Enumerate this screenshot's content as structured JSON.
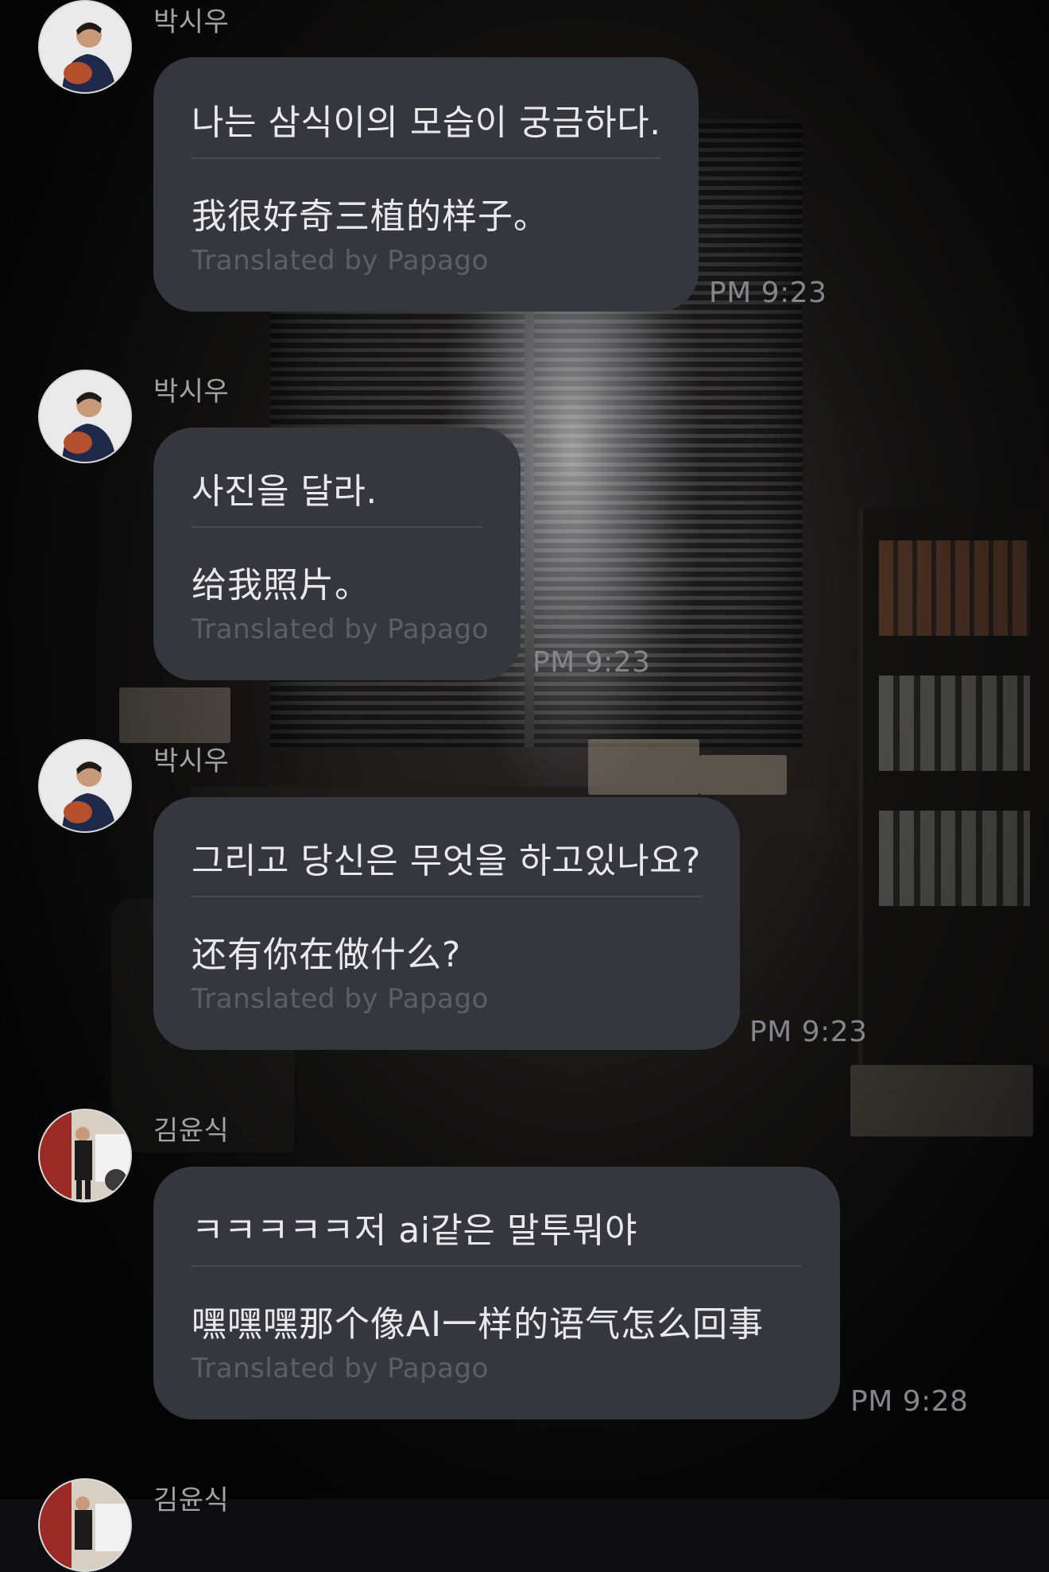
{
  "messages": [
    {
      "sender": "박시우",
      "avatar": "profile-photo",
      "original": "나는 삼식이의 모습이 궁금하다.",
      "translated": "我很好奇三植的样子。",
      "credit": "Translated by Papago",
      "time": "PM 9:23"
    },
    {
      "sender": "박시우",
      "avatar": "profile-photo",
      "original": "사진을 달라.",
      "translated": "给我照片。",
      "credit": "Translated by Papago",
      "time": "PM 9:23"
    },
    {
      "sender": "박시우",
      "avatar": "profile-photo",
      "original": "그리고 당신은 무엇을 하고있나요?",
      "translated": "还有你在做什么?",
      "credit": "Translated by Papago",
      "time": "PM 9:23"
    },
    {
      "sender": "김윤식",
      "avatar": "profile-photo",
      "original": "ㅋㅋㅋㅋㅋ저 ai같은 말투뭐야",
      "translated": "嘿嘿嘿那个像AI一样的语气怎么回事",
      "credit": "Translated by Papago",
      "time": "PM 9:28"
    },
    {
      "sender": "김윤식",
      "avatar": "profile-photo"
    }
  ],
  "colors": {
    "bubble": "#36373e",
    "text": "#e9e9ec",
    "sender": "#a3a3a6",
    "credit": "#5e5f66",
    "time": "#85868c"
  }
}
